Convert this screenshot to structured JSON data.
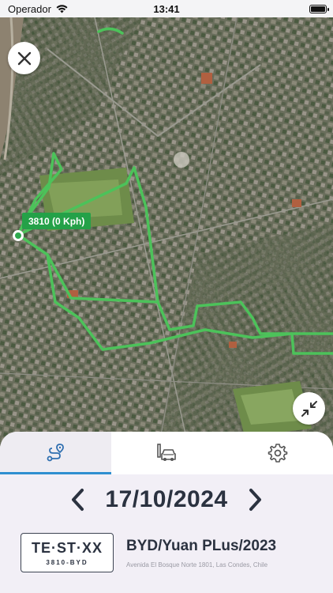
{
  "status_bar": {
    "carrier": "Operador",
    "time": "13:41",
    "battery_level": 1.0
  },
  "map": {
    "speed_label": "3810 (0 Kph)",
    "route_color": "#4cc25a",
    "close_icon": "close-icon",
    "compress_icon": "compress-arrows-icon"
  },
  "tabs": [
    {
      "icon": "route-icon",
      "active": true
    },
    {
      "icon": "vehicle-icon",
      "active": false
    },
    {
      "icon": "gear-icon",
      "active": false
    }
  ],
  "date": {
    "value": "17/10/2024",
    "prev_icon": "chevron-left-icon",
    "next_icon": "chevron-right-icon"
  },
  "vehicle": {
    "plate_main": "TE·ST·XX",
    "plate_sub": "3810-BYD",
    "name": "BYD/Yuan PLus/2023",
    "address": "Avenida El Bosque Norte 1801, Las Condes, Chile"
  },
  "colors": {
    "accent": "#2f8fd0",
    "label_green": "#24a148",
    "text_dark": "#2b3240"
  }
}
